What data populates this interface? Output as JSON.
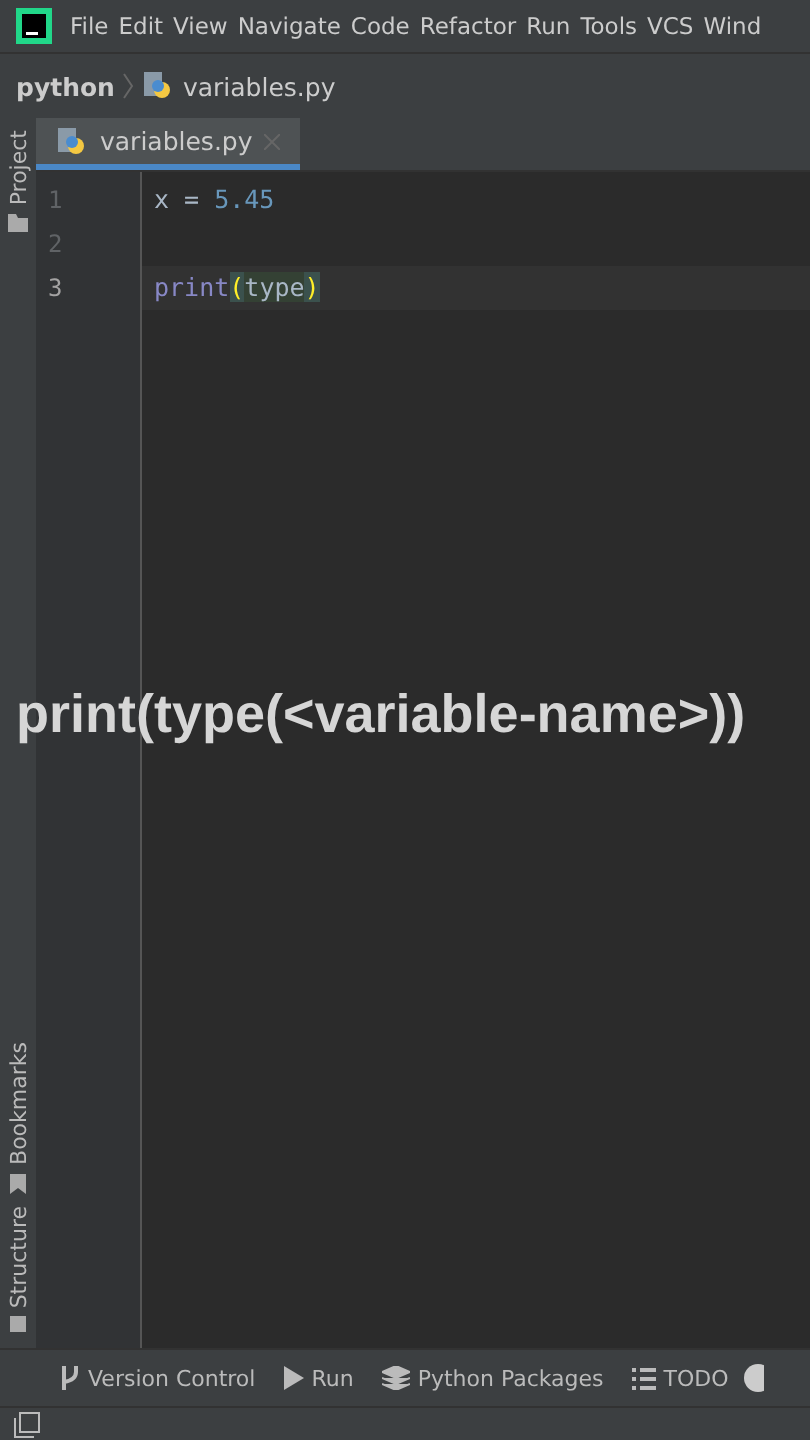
{
  "menu": [
    "File",
    "Edit",
    "View",
    "Navigate",
    "Code",
    "Refactor",
    "Run",
    "Tools",
    "VCS",
    "Wind"
  ],
  "breadcrumb": {
    "project": "python",
    "file": "variables.py"
  },
  "left_stripe": [
    {
      "label": "Project",
      "kind": "project"
    },
    {
      "label": "Bookmarks",
      "kind": "bookmarks"
    },
    {
      "label": "Structure",
      "kind": "structure"
    }
  ],
  "tabs": [
    {
      "label": "variables.py",
      "selected": true
    }
  ],
  "code_lines": [
    {
      "number": "1",
      "current": false,
      "tokens": [
        {
          "text": "x = ",
          "kind": "plain"
        },
        {
          "text": "5.45",
          "kind": "number"
        }
      ]
    },
    {
      "number": "2",
      "current": false
    },
    {
      "number": "3",
      "current": true,
      "tokens": [
        {
          "text": "print",
          "kind": "builtin"
        },
        {
          "text": "(",
          "kind": "brace"
        },
        {
          "text": "type",
          "kind": "plain_hl"
        },
        {
          "text": ")",
          "kind": "brace"
        }
      ]
    }
  ],
  "caption": "print(type(<variable-name>))",
  "tool_windows": [
    {
      "label": "Version Control",
      "kind": "vcs"
    },
    {
      "label": "Run",
      "kind": "run"
    },
    {
      "label": "Python Packages",
      "kind": "packages"
    },
    {
      "label": "TODO",
      "kind": "todo"
    }
  ]
}
